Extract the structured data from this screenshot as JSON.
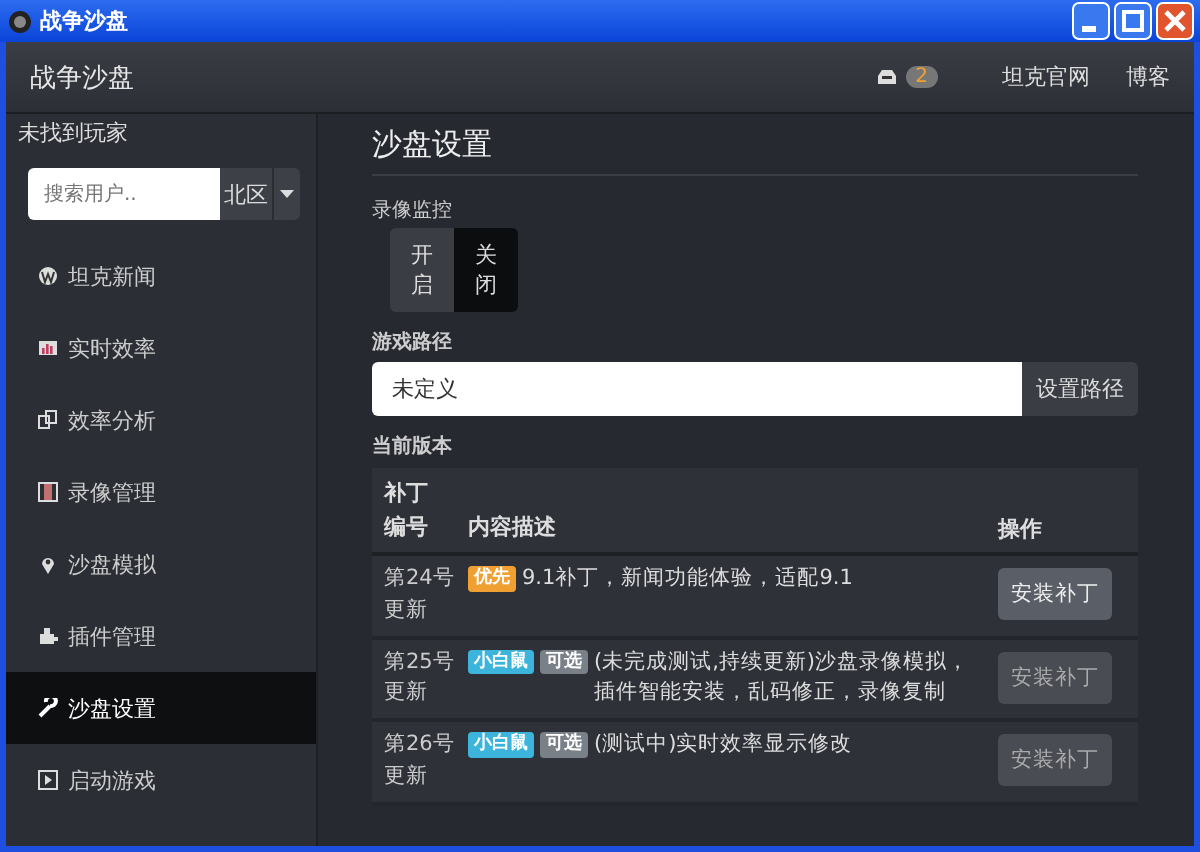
{
  "window": {
    "title": "战争沙盘"
  },
  "header": {
    "app_name": "战争沙盘",
    "message_count": "2",
    "links": [
      "坦克官网",
      "博客"
    ]
  },
  "sidebar": {
    "player_status": "未找到玩家",
    "search": {
      "placeholder": "搜索用户.."
    },
    "region": "北区",
    "items": [
      {
        "label": "坦克新闻",
        "selected": false
      },
      {
        "label": "实时效率",
        "selected": false
      },
      {
        "label": "效率分析",
        "selected": false
      },
      {
        "label": "录像管理",
        "selected": false
      },
      {
        "label": "沙盘模拟",
        "selected": false
      },
      {
        "label": "插件管理",
        "selected": false
      },
      {
        "label": "沙盘设置",
        "selected": true
      },
      {
        "label": "启动游戏",
        "selected": false
      }
    ]
  },
  "main": {
    "title": "沙盘设置",
    "recording": {
      "label": "录像监控",
      "options": [
        {
          "label": "开启",
          "selected": false
        },
        {
          "label": "关闭",
          "selected": true
        }
      ]
    },
    "game_path": {
      "label": "游戏路径",
      "value": "未定义",
      "button": "设置路径"
    },
    "version": {
      "label": "当前版本",
      "columns": [
        "补丁编号",
        "内容描述",
        "操作"
      ],
      "rows": [
        {
          "number": "第24号更新",
          "tags": [
            {
              "text": "优先",
              "color": "#f0a030"
            }
          ],
          "description": "9.1补丁，新闻功能体验，适配9.1",
          "button": "安装补丁",
          "disabled": false
        },
        {
          "number": "第25号更新",
          "tags": [
            {
              "text": "小白鼠",
              "color": "#3cb4dc"
            },
            {
              "text": "可选",
              "color": "#7a8088"
            }
          ],
          "description": "(未完成测试,持续更新)沙盘录像模拟，插件智能安装，乱码修正，录像复制",
          "button": "安装补丁",
          "disabled": true
        },
        {
          "number": "第26号更新",
          "tags": [
            {
              "text": "小白鼠",
              "color": "#3cb4dc"
            },
            {
              "text": "可选",
              "color": "#7a8088"
            }
          ],
          "description": "(测试中)实时效率显示修改",
          "button": "安装补丁",
          "disabled": true
        }
      ]
    }
  }
}
